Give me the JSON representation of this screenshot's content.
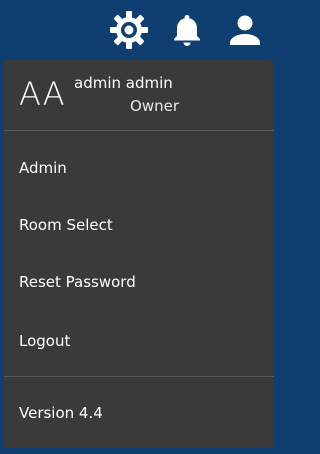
{
  "topbar": {
    "icons": [
      "settings-gear-icon",
      "notification-bell-icon",
      "user-account-icon"
    ],
    "background": "#0e3f70",
    "icon_color": "#ffffff"
  },
  "profile": {
    "initials": "AA",
    "name": "admin admin",
    "role": "Owner"
  },
  "menu": {
    "background": "#3a3a3a",
    "items": [
      {
        "label": "Admin"
      },
      {
        "label": "Room Select"
      },
      {
        "label": "Reset Password"
      },
      {
        "label": "Logout"
      }
    ]
  },
  "footer": {
    "version": "Version 4.4"
  }
}
